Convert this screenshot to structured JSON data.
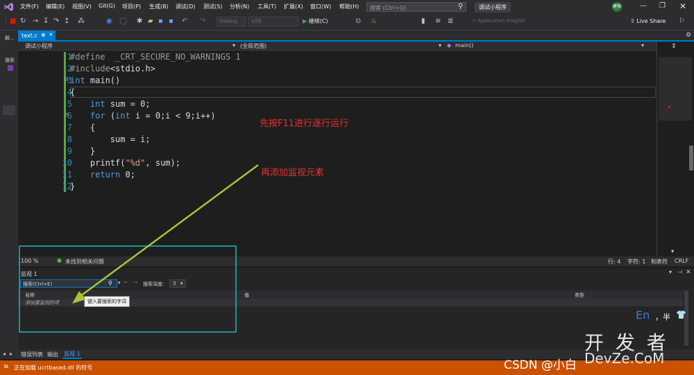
{
  "menu": [
    "文件(F)",
    "编辑(E)",
    "视图(V)",
    "Git(G)",
    "项目(P)",
    "生成(B)",
    "调试(D)",
    "测试(S)",
    "分析(N)",
    "工具(T)",
    "扩展(X)",
    "窗口(W)",
    "帮助(H)"
  ],
  "search_placeholder": "搜索 (Ctrl+Q)",
  "window_title": "调试小程序",
  "user_initials": "建韬",
  "live_share": "Live Share",
  "toolbar": {
    "config": "Debug",
    "platform": "x86",
    "continue": "继续(C)",
    "app_insights": "Application Insights"
  },
  "left_strip": {
    "top": "解...",
    "search": "搜索"
  },
  "tab": {
    "name": "text.c",
    "pin": "⊕",
    "close": "×"
  },
  "nav": {
    "project": "调试小程序",
    "scope": "(全局范围)",
    "func": "main()"
  },
  "code_lines": [
    {
      "n": "1",
      "text": "#define  _CRT_SECURE_NO_WARNINGS 1"
    },
    {
      "n": "2",
      "text": "#include<stdio.h>"
    },
    {
      "n": "3",
      "text": "int main()"
    },
    {
      "n": "4",
      "text": "{"
    },
    {
      "n": "5",
      "text": "    int sum = 0;"
    },
    {
      "n": "6",
      "text": "    for (int i = 0;i < 9;i++)"
    },
    {
      "n": "7",
      "text": "    {"
    },
    {
      "n": "8",
      "text": "        sum = i;"
    },
    {
      "n": "9",
      "text": "    }"
    },
    {
      "n": "10",
      "text": "    printf(\"%d\", sum);"
    },
    {
      "n": "11",
      "text": "    return 0;"
    },
    {
      "n": "12",
      "text": "}"
    }
  ],
  "annotations": {
    "a1": "先按F11进行逐行运行",
    "a2": "再添加监视元素"
  },
  "editor_status": {
    "zoom": "100 %",
    "issues": "未找到相关问题",
    "line": "行: 4",
    "col": "字符: 1",
    "tabs": "制表符",
    "eol": "CRLF"
  },
  "watch": {
    "title": "监视 1",
    "search_placeholder": "搜索(Ctrl+E)",
    "depth_label": "搜索深度:",
    "depth_value": "3",
    "col_name": "名称",
    "col_value": "值",
    "col_type": "类型",
    "add_item": "添加要监视的项",
    "tooltip": "键入要搜索的字词"
  },
  "ime": {
    "lang": "En",
    "mode": "，半"
  },
  "bottom_tabs": [
    "错误列表",
    "输出",
    "监视 1"
  ],
  "status": {
    "text": "正在加载 ucrtbased.dll 的符号"
  },
  "watermarks": {
    "csdn": "CSDN @小白",
    "devze_cn": "开 发 者",
    "devze_en": "DevZe.CoM"
  },
  "colors": {
    "accent": "#007acc",
    "status": "#ca5100",
    "annotation": "#e8302e",
    "box": "#1fb8c4",
    "arrow": "#a4c639",
    "breakpoint": "#e51400"
  }
}
